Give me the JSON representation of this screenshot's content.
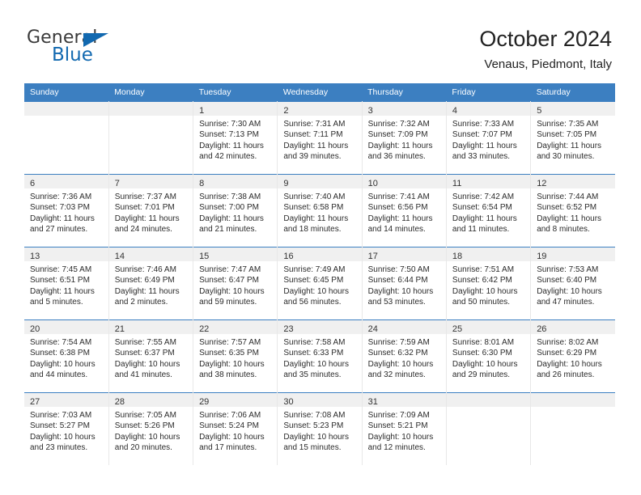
{
  "brand": {
    "name_top": "General",
    "name_bottom": "Blue",
    "flag_icon": "blue-triangle-flag",
    "colors": {
      "blue": "#1269b0",
      "dark": "#3a3a3a"
    }
  },
  "header": {
    "title": "October 2024",
    "subtitle": "Venaus, Piedmont, Italy"
  },
  "calendar": {
    "accent_color": "#3c7fc1",
    "daynum_band_color": "#f0f0f0",
    "weekday_headers": [
      "Sunday",
      "Monday",
      "Tuesday",
      "Wednesday",
      "Thursday",
      "Friday",
      "Saturday"
    ],
    "weeks": [
      [
        {
          "day": "",
          "empty": true
        },
        {
          "day": "",
          "empty": true
        },
        {
          "day": "1",
          "sunrise": "Sunrise: 7:30 AM",
          "sunset": "Sunset: 7:13 PM",
          "daylight_1": "Daylight: 11 hours",
          "daylight_2": "and 42 minutes."
        },
        {
          "day": "2",
          "sunrise": "Sunrise: 7:31 AM",
          "sunset": "Sunset: 7:11 PM",
          "daylight_1": "Daylight: 11 hours",
          "daylight_2": "and 39 minutes."
        },
        {
          "day": "3",
          "sunrise": "Sunrise: 7:32 AM",
          "sunset": "Sunset: 7:09 PM",
          "daylight_1": "Daylight: 11 hours",
          "daylight_2": "and 36 minutes."
        },
        {
          "day": "4",
          "sunrise": "Sunrise: 7:33 AM",
          "sunset": "Sunset: 7:07 PM",
          "daylight_1": "Daylight: 11 hours",
          "daylight_2": "and 33 minutes."
        },
        {
          "day": "5",
          "sunrise": "Sunrise: 7:35 AM",
          "sunset": "Sunset: 7:05 PM",
          "daylight_1": "Daylight: 11 hours",
          "daylight_2": "and 30 minutes."
        }
      ],
      [
        {
          "day": "6",
          "sunrise": "Sunrise: 7:36 AM",
          "sunset": "Sunset: 7:03 PM",
          "daylight_1": "Daylight: 11 hours",
          "daylight_2": "and 27 minutes."
        },
        {
          "day": "7",
          "sunrise": "Sunrise: 7:37 AM",
          "sunset": "Sunset: 7:01 PM",
          "daylight_1": "Daylight: 11 hours",
          "daylight_2": "and 24 minutes."
        },
        {
          "day": "8",
          "sunrise": "Sunrise: 7:38 AM",
          "sunset": "Sunset: 7:00 PM",
          "daylight_1": "Daylight: 11 hours",
          "daylight_2": "and 21 minutes."
        },
        {
          "day": "9",
          "sunrise": "Sunrise: 7:40 AM",
          "sunset": "Sunset: 6:58 PM",
          "daylight_1": "Daylight: 11 hours",
          "daylight_2": "and 18 minutes."
        },
        {
          "day": "10",
          "sunrise": "Sunrise: 7:41 AM",
          "sunset": "Sunset: 6:56 PM",
          "daylight_1": "Daylight: 11 hours",
          "daylight_2": "and 14 minutes."
        },
        {
          "day": "11",
          "sunrise": "Sunrise: 7:42 AM",
          "sunset": "Sunset: 6:54 PM",
          "daylight_1": "Daylight: 11 hours",
          "daylight_2": "and 11 minutes."
        },
        {
          "day": "12",
          "sunrise": "Sunrise: 7:44 AM",
          "sunset": "Sunset: 6:52 PM",
          "daylight_1": "Daylight: 11 hours",
          "daylight_2": "and 8 minutes."
        }
      ],
      [
        {
          "day": "13",
          "sunrise": "Sunrise: 7:45 AM",
          "sunset": "Sunset: 6:51 PM",
          "daylight_1": "Daylight: 11 hours",
          "daylight_2": "and 5 minutes."
        },
        {
          "day": "14",
          "sunrise": "Sunrise: 7:46 AM",
          "sunset": "Sunset: 6:49 PM",
          "daylight_1": "Daylight: 11 hours",
          "daylight_2": "and 2 minutes."
        },
        {
          "day": "15",
          "sunrise": "Sunrise: 7:47 AM",
          "sunset": "Sunset: 6:47 PM",
          "daylight_1": "Daylight: 10 hours",
          "daylight_2": "and 59 minutes."
        },
        {
          "day": "16",
          "sunrise": "Sunrise: 7:49 AM",
          "sunset": "Sunset: 6:45 PM",
          "daylight_1": "Daylight: 10 hours",
          "daylight_2": "and 56 minutes."
        },
        {
          "day": "17",
          "sunrise": "Sunrise: 7:50 AM",
          "sunset": "Sunset: 6:44 PM",
          "daylight_1": "Daylight: 10 hours",
          "daylight_2": "and 53 minutes."
        },
        {
          "day": "18",
          "sunrise": "Sunrise: 7:51 AM",
          "sunset": "Sunset: 6:42 PM",
          "daylight_1": "Daylight: 10 hours",
          "daylight_2": "and 50 minutes."
        },
        {
          "day": "19",
          "sunrise": "Sunrise: 7:53 AM",
          "sunset": "Sunset: 6:40 PM",
          "daylight_1": "Daylight: 10 hours",
          "daylight_2": "and 47 minutes."
        }
      ],
      [
        {
          "day": "20",
          "sunrise": "Sunrise: 7:54 AM",
          "sunset": "Sunset: 6:38 PM",
          "daylight_1": "Daylight: 10 hours",
          "daylight_2": "and 44 minutes."
        },
        {
          "day": "21",
          "sunrise": "Sunrise: 7:55 AM",
          "sunset": "Sunset: 6:37 PM",
          "daylight_1": "Daylight: 10 hours",
          "daylight_2": "and 41 minutes."
        },
        {
          "day": "22",
          "sunrise": "Sunrise: 7:57 AM",
          "sunset": "Sunset: 6:35 PM",
          "daylight_1": "Daylight: 10 hours",
          "daylight_2": "and 38 minutes."
        },
        {
          "day": "23",
          "sunrise": "Sunrise: 7:58 AM",
          "sunset": "Sunset: 6:33 PM",
          "daylight_1": "Daylight: 10 hours",
          "daylight_2": "and 35 minutes."
        },
        {
          "day": "24",
          "sunrise": "Sunrise: 7:59 AM",
          "sunset": "Sunset: 6:32 PM",
          "daylight_1": "Daylight: 10 hours",
          "daylight_2": "and 32 minutes."
        },
        {
          "day": "25",
          "sunrise": "Sunrise: 8:01 AM",
          "sunset": "Sunset: 6:30 PM",
          "daylight_1": "Daylight: 10 hours",
          "daylight_2": "and 29 minutes."
        },
        {
          "day": "26",
          "sunrise": "Sunrise: 8:02 AM",
          "sunset": "Sunset: 6:29 PM",
          "daylight_1": "Daylight: 10 hours",
          "daylight_2": "and 26 minutes."
        }
      ],
      [
        {
          "day": "27",
          "sunrise": "Sunrise: 7:03 AM",
          "sunset": "Sunset: 5:27 PM",
          "daylight_1": "Daylight: 10 hours",
          "daylight_2": "and 23 minutes."
        },
        {
          "day": "28",
          "sunrise": "Sunrise: 7:05 AM",
          "sunset": "Sunset: 5:26 PM",
          "daylight_1": "Daylight: 10 hours",
          "daylight_2": "and 20 minutes."
        },
        {
          "day": "29",
          "sunrise": "Sunrise: 7:06 AM",
          "sunset": "Sunset: 5:24 PM",
          "daylight_1": "Daylight: 10 hours",
          "daylight_2": "and 17 minutes."
        },
        {
          "day": "30",
          "sunrise": "Sunrise: 7:08 AM",
          "sunset": "Sunset: 5:23 PM",
          "daylight_1": "Daylight: 10 hours",
          "daylight_2": "and 15 minutes."
        },
        {
          "day": "31",
          "sunrise": "Sunrise: 7:09 AM",
          "sunset": "Sunset: 5:21 PM",
          "daylight_1": "Daylight: 10 hours",
          "daylight_2": "and 12 minutes."
        },
        {
          "day": "",
          "empty": true
        },
        {
          "day": "",
          "empty": true
        }
      ]
    ]
  }
}
